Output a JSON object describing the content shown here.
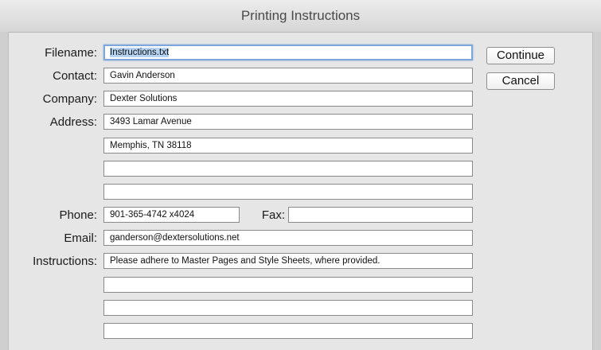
{
  "window": {
    "title": "Printing Instructions"
  },
  "labels": {
    "filename": "Filename:",
    "contact": "Contact:",
    "company": "Company:",
    "address": "Address:",
    "phone": "Phone:",
    "fax": "Fax:",
    "email": "Email:",
    "instructions": "Instructions:"
  },
  "fields": {
    "filename": "Instructions.txt",
    "contact": "Gavin Anderson",
    "company": "Dexter Solutions",
    "address1": "3493 Lamar Avenue",
    "address2": "Memphis, TN 38118",
    "address3": "",
    "address4": "",
    "phone": "901-365-4742 x4024",
    "fax": "",
    "email": "ganderson@dextersolutions.net",
    "instructions1": "Please adhere to Master Pages and Style Sheets, where provided.",
    "instructions2": "",
    "instructions3": "",
    "instructions4": ""
  },
  "buttons": {
    "continue": "Continue",
    "cancel": "Cancel"
  }
}
